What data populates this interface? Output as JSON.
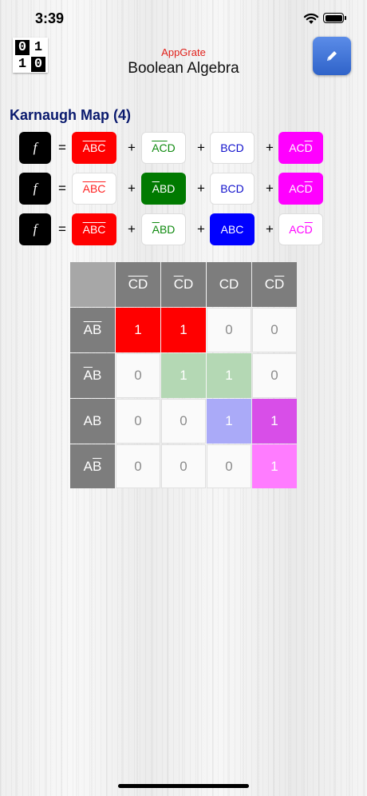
{
  "status": {
    "time": "3:39"
  },
  "header": {
    "logo": [
      "0",
      "1",
      "1",
      "0"
    ],
    "brand": "AppGrate",
    "title": "Boolean Algebra",
    "edit_icon": "pencil-icon"
  },
  "section_title": "Karnaugh Map (4)",
  "expressions": [
    {
      "f": "f",
      "eq": "=",
      "plus": "+",
      "terms": [
        {
          "parts": [
            {
              "t": "A",
              "ov": true
            },
            {
              "t": "B",
              "ov": true
            },
            {
              "t": "C",
              "ov": true
            }
          ],
          "bg": "#ff0000",
          "fg": "#ffffff",
          "outline": false
        },
        {
          "parts": [
            {
              "t": "A",
              "ov": true
            },
            {
              "t": "C",
              "ov": true
            },
            {
              "t": "D",
              "ov": false
            }
          ],
          "bg": "#ffffff",
          "fg": "#0f8a0f",
          "outline": true
        },
        {
          "parts": [
            {
              "t": "B",
              "ov": false
            },
            {
              "t": "C",
              "ov": false
            },
            {
              "t": "D",
              "ov": false
            }
          ],
          "bg": "#ffffff",
          "fg": "#1010cc",
          "outline": true
        },
        {
          "parts": [
            {
              "t": "A",
              "ov": false
            },
            {
              "t": "C",
              "ov": false
            },
            {
              "t": "D",
              "ov": true
            }
          ],
          "bg": "#ff00ff",
          "fg": "#ffffff",
          "outline": false
        }
      ]
    },
    {
      "f": "f",
      "eq": "=",
      "plus": "+",
      "terms": [
        {
          "parts": [
            {
              "t": "A",
              "ov": true
            },
            {
              "t": "B",
              "ov": true
            },
            {
              "t": "C",
              "ov": true
            }
          ],
          "bg": "#ffffff",
          "fg": "#ff2020",
          "outline": true
        },
        {
          "parts": [
            {
              "t": "A",
              "ov": true
            },
            {
              "t": "B",
              "ov": false
            },
            {
              "t": "D",
              "ov": false
            }
          ],
          "bg": "#007a00",
          "fg": "#ffffff",
          "outline": false
        },
        {
          "parts": [
            {
              "t": "B",
              "ov": false
            },
            {
              "t": "C",
              "ov": false
            },
            {
              "t": "D",
              "ov": false
            }
          ],
          "bg": "#ffffff",
          "fg": "#1010cc",
          "outline": true
        },
        {
          "parts": [
            {
              "t": "A",
              "ov": false
            },
            {
              "t": "C",
              "ov": false
            },
            {
              "t": "D",
              "ov": true
            }
          ],
          "bg": "#ff00ff",
          "fg": "#ffffff",
          "outline": false
        }
      ]
    },
    {
      "f": "f",
      "eq": "=",
      "plus": "+",
      "terms": [
        {
          "parts": [
            {
              "t": "A",
              "ov": true
            },
            {
              "t": "B",
              "ov": true
            },
            {
              "t": "C",
              "ov": true
            }
          ],
          "bg": "#ff0000",
          "fg": "#ffffff",
          "outline": false
        },
        {
          "parts": [
            {
              "t": "A",
              "ov": true
            },
            {
              "t": "B",
              "ov": false
            },
            {
              "t": "D",
              "ov": false
            }
          ],
          "bg": "#ffffff",
          "fg": "#0f8a0f",
          "outline": true
        },
        {
          "parts": [
            {
              "t": "A",
              "ov": false
            },
            {
              "t": "B",
              "ov": false
            },
            {
              "t": "C",
              "ov": false
            }
          ],
          "bg": "#0000ff",
          "fg": "#ffffff",
          "outline": false
        },
        {
          "parts": [
            {
              "t": "A",
              "ov": false
            },
            {
              "t": "C",
              "ov": false
            },
            {
              "t": "D",
              "ov": true
            }
          ],
          "bg": "#ffffff",
          "fg": "#ff00ff",
          "outline": true
        }
      ]
    }
  ],
  "kmap": {
    "col_headers": [
      [
        {
          "t": "C",
          "ov": true
        },
        {
          "t": "D",
          "ov": true
        }
      ],
      [
        {
          "t": "C",
          "ov": true
        },
        {
          "t": "D",
          "ov": false
        }
      ],
      [
        {
          "t": "C",
          "ov": false
        },
        {
          "t": "D",
          "ov": false
        }
      ],
      [
        {
          "t": "C",
          "ov": false
        },
        {
          "t": "D",
          "ov": true
        }
      ]
    ],
    "row_headers": [
      [
        {
          "t": "A",
          "ov": true
        },
        {
          "t": "B",
          "ov": true
        }
      ],
      [
        {
          "t": "A",
          "ov": true
        },
        {
          "t": "B",
          "ov": false
        }
      ],
      [
        {
          "t": "A",
          "ov": false
        },
        {
          "t": "B",
          "ov": false
        }
      ],
      [
        {
          "t": "A",
          "ov": false
        },
        {
          "t": "B",
          "ov": true
        }
      ]
    ],
    "cells": [
      [
        {
          "v": "1",
          "bg": "#ff0000",
          "fg": "#ffffff"
        },
        {
          "v": "1",
          "bg": "#ff0000",
          "fg": "#ffffff"
        },
        {
          "v": "0",
          "bg": "",
          "fg": ""
        },
        {
          "v": "0",
          "bg": "",
          "fg": ""
        }
      ],
      [
        {
          "v": "0",
          "bg": "",
          "fg": ""
        },
        {
          "v": "1",
          "bg": "#b4d8b4",
          "fg": "#ffffff"
        },
        {
          "v": "1",
          "bg": "#b4d8b4",
          "fg": "#ffffff"
        },
        {
          "v": "0",
          "bg": "",
          "fg": ""
        }
      ],
      [
        {
          "v": "0",
          "bg": "",
          "fg": ""
        },
        {
          "v": "0",
          "bg": "",
          "fg": ""
        },
        {
          "v": "1",
          "bg": "#aaaaf8",
          "fg": "#ffffff"
        },
        {
          "v": "1",
          "bg": "#d84ee8",
          "fg": "#ffffff"
        }
      ],
      [
        {
          "v": "0",
          "bg": "",
          "fg": ""
        },
        {
          "v": "0",
          "bg": "",
          "fg": ""
        },
        {
          "v": "0",
          "bg": "",
          "fg": ""
        },
        {
          "v": "1",
          "bg": "#ff7cff",
          "fg": "#ffffff"
        }
      ]
    ]
  }
}
